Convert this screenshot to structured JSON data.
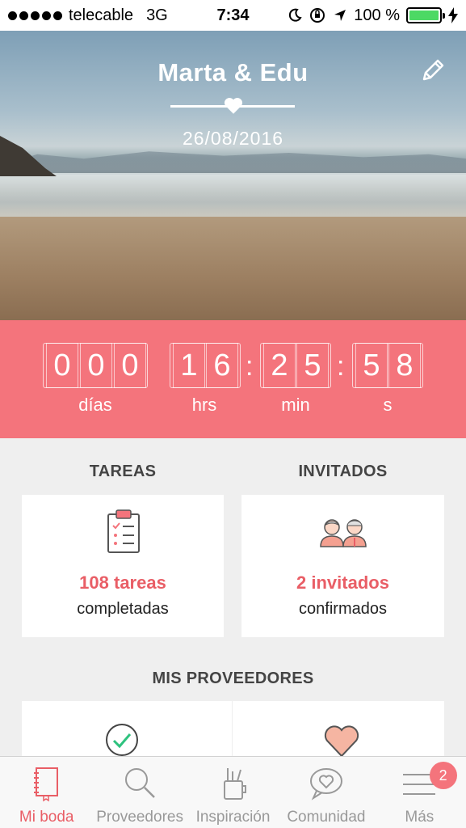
{
  "status_bar": {
    "carrier": "telecable",
    "network": "3G",
    "time": "7:34",
    "battery": "100 %",
    "battery_level": 1.0
  },
  "hero": {
    "title": "Marta & Edu",
    "date": "26/08/2016"
  },
  "countdown": {
    "days": [
      "0",
      "0",
      "0"
    ],
    "hours": [
      "1",
      "6"
    ],
    "minutes": [
      "2",
      "5"
    ],
    "seconds": [
      "5",
      "8"
    ],
    "labels": {
      "days": "días",
      "hours": "hrs",
      "minutes": "min",
      "seconds": "s"
    }
  },
  "tasks": {
    "heading": "TAREAS",
    "main": "108 tareas",
    "sub": "completadas"
  },
  "guests": {
    "heading": "INVITADOS",
    "main": "2 invitados",
    "sub": "confirmados"
  },
  "vendors": {
    "heading": "MIS PROVEEDORES"
  },
  "tabbar": {
    "items": [
      {
        "label": "Mi boda",
        "icon": "notebook-icon"
      },
      {
        "label": "Proveedores",
        "icon": "search-icon"
      },
      {
        "label": "Inspiración",
        "icon": "pencil-cup-icon"
      },
      {
        "label": "Comunidad",
        "icon": "chat-heart-icon"
      },
      {
        "label": "Más",
        "icon": "menu-icon"
      }
    ],
    "badge": "2"
  },
  "colors": {
    "accent": "#f4747c",
    "accent_text": "#e95e66",
    "battery": "#4cd964"
  }
}
